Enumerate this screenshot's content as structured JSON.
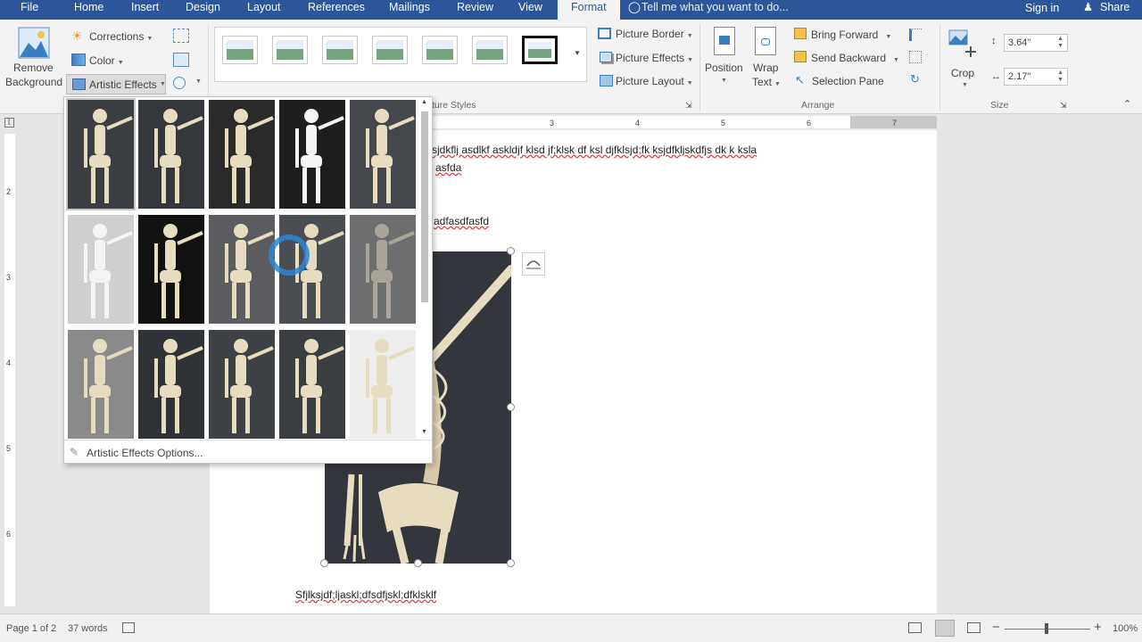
{
  "tabs": {
    "file": "File",
    "home": "Home",
    "insert": "Insert",
    "design": "Design",
    "layout": "Layout",
    "references": "References",
    "mailings": "Mailings",
    "review": "Review",
    "view": "View",
    "format": "Format",
    "tell_me": "Tell me what you want to do...",
    "sign_in": "Sign in",
    "share": "Share"
  },
  "ribbon": {
    "adjust": {
      "remove_bg_1": "Remove",
      "remove_bg_2": "Background",
      "corrections": "Corrections",
      "color": "Color",
      "artistic_effects": "Artistic Effects"
    },
    "styles": {
      "group_label": "ture Styles",
      "thumbnail_count": 7
    },
    "picture": {
      "border": "Picture Border",
      "effects": "Picture Effects",
      "layout": "Picture Layout"
    },
    "arrange": {
      "group_label": "Arrange",
      "position": "Position",
      "wrap_1": "Wrap",
      "wrap_2": "Text",
      "bring_forward": "Bring Forward",
      "send_backward": "Send Backward",
      "selection_pane": "Selection Pane"
    },
    "size": {
      "group_label": "Size",
      "crop": "Crop",
      "height": "3.64\"",
      "width": "2.17\""
    }
  },
  "ruler": {
    "ticks": [
      "3",
      "4",
      "5",
      "6",
      "7"
    ]
  },
  "vruler": {
    "ticks": [
      "2",
      "3",
      "4",
      "5",
      "6"
    ]
  },
  "gallery": {
    "options_label": "Artistic Effects Options...",
    "rows": 3,
    "cols": 5,
    "selected_index": 0,
    "effects": [
      "None",
      "Marker",
      "Pencil Grayscale",
      "Pencil Sketch",
      "Line Drawing",
      "Chalk Sketch",
      "Paint Strokes",
      "Paint Brush",
      "Glow Diffused",
      "Blur",
      "Light Screen",
      "Watercolor Sponge",
      "Film Grain",
      "Mosaic Bubbles",
      "Glass"
    ]
  },
  "document": {
    "line1": "sjdkflj asdlkf askldjf klsd jf;klsk df ksl djfklsjd;fk ksjdfkljskdfjs dk k ksla",
    "line2": "asfda",
    "line3": "adfasdfasfd",
    "line4": "Sfjlksjdf;ljaskl;dfsdfjskl;dfklsklf"
  },
  "status": {
    "page": "Page 1 of 2",
    "words": "37 words",
    "zoom": "100%",
    "zoom_minus": "−",
    "zoom_plus": "+"
  },
  "colors": {
    "accent": "#2b579a",
    "page": "#ffffff",
    "picture_bg": "#33363c",
    "bone": "#e8dcc0"
  }
}
